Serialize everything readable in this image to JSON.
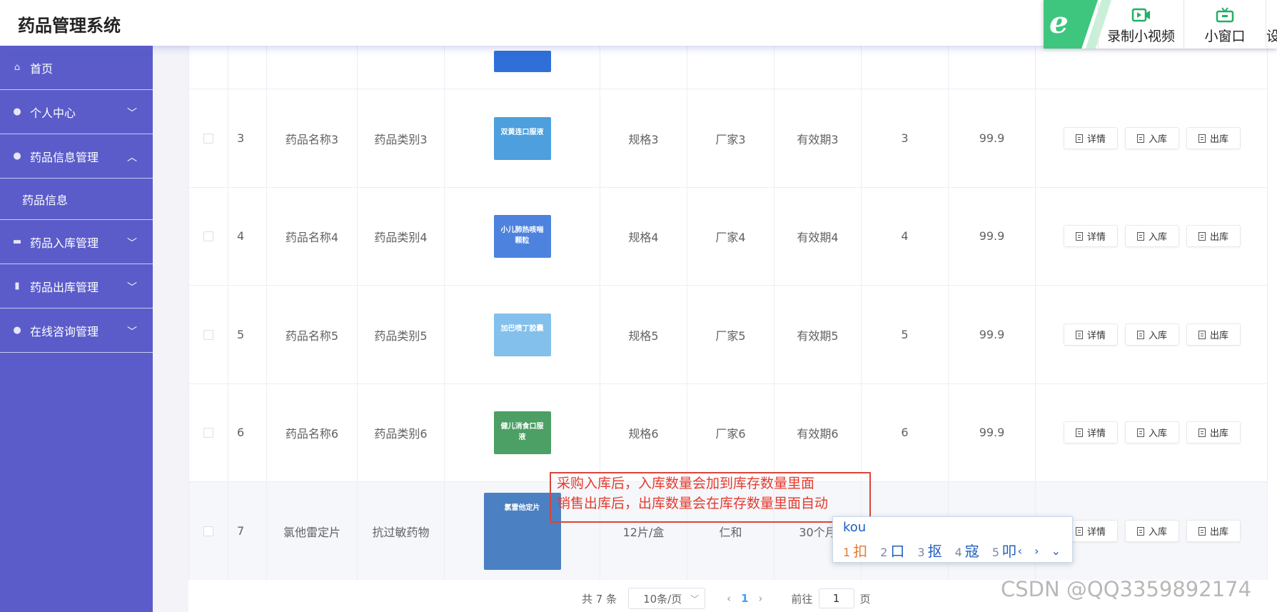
{
  "header": {
    "title": "药品管理系统"
  },
  "recorder": {
    "record_label": "录制小视频",
    "window_label": "小窗口",
    "partial_label": "设"
  },
  "sidebar": {
    "items": [
      {
        "label": "首页"
      },
      {
        "label": "个人中心"
      },
      {
        "label": "药品信息管理"
      },
      {
        "label": "药品信息"
      },
      {
        "label": "药品入库管理"
      },
      {
        "label": "药品出库管理"
      },
      {
        "label": "在线咨询管理"
      }
    ]
  },
  "table": {
    "rows": [
      {
        "no": "3",
        "name": "药品名称3",
        "category": "药品类别3",
        "spec": "规格3",
        "maker": "厂家3",
        "expiry": "有效期3",
        "stock": "3",
        "price": "99.9",
        "pic_text": "双黄连口服液",
        "pic_color": "#2f8fd8"
      },
      {
        "no": "4",
        "name": "药品名称4",
        "category": "药品类别4",
        "spec": "规格4",
        "maker": "厂家4",
        "expiry": "有效期4",
        "stock": "4",
        "price": "99.9",
        "pic_text": "小儿肺热咳喘颗粒",
        "pic_color": "#2f6fd8"
      },
      {
        "no": "5",
        "name": "药品名称5",
        "category": "药品类别5",
        "spec": "规格5",
        "maker": "厂家5",
        "expiry": "有效期5",
        "stock": "5",
        "price": "99.9",
        "pic_text": "加巴喷丁胶囊",
        "pic_color": "#6fb6e8"
      },
      {
        "no": "6",
        "name": "药品名称6",
        "category": "药品类别6",
        "spec": "规格6",
        "maker": "厂家6",
        "expiry": "有效期6",
        "stock": "6",
        "price": "99.9",
        "pic_text": "健儿消食口服液",
        "pic_color": "#2e8f4a"
      },
      {
        "no": "7",
        "name": "氯他雷定片",
        "category": "抗过敏药物",
        "spec": "12片/盒",
        "maker": "仁和",
        "expiry": "30个月",
        "stock": "",
        "price": "",
        "pic_text": "氯雷他定片",
        "pic_color": "#2d6bb8"
      }
    ],
    "actions": {
      "detail": "详情",
      "stock_in": "入库",
      "stock_out": "出库"
    }
  },
  "annotation": {
    "line1": "采购入库后，入库数量会加到库存数量里面",
    "line2": "销售出库后，出库数量会在库存数量里面自动"
  },
  "ime": {
    "typed": "kou",
    "candidates": [
      {
        "n": "1",
        "c": "扣"
      },
      {
        "n": "2",
        "c": "口"
      },
      {
        "n": "3",
        "c": "抠"
      },
      {
        "n": "4",
        "c": "寇"
      },
      {
        "n": "5",
        "c": "叩"
      }
    ]
  },
  "pagination": {
    "total": "共 7 条",
    "page_size": "10条/页",
    "current": "1",
    "goto_label": "前往",
    "goto_value": "1",
    "page_suffix": "页"
  },
  "watermark": "CSDN @QQ3359892174"
}
